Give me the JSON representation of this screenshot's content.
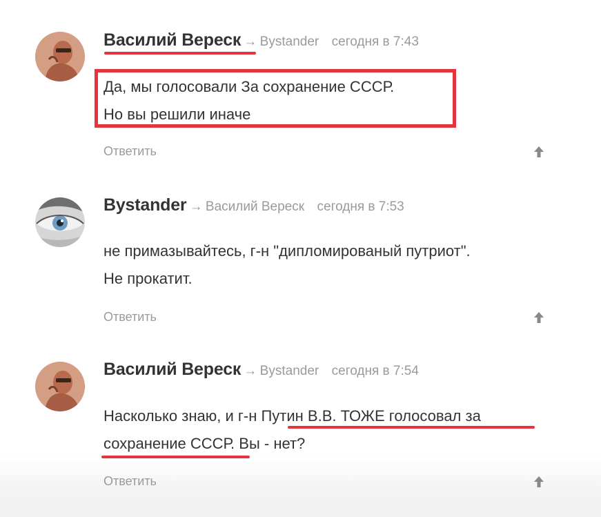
{
  "comments": [
    {
      "author": "Василий Вереск",
      "arrow": "→",
      "reply_to": "Bystander",
      "time": "сегодня в 7:43",
      "lines": [
        "Да, мы голосовали За сохранение СССР.",
        "Но вы решили иначе"
      ],
      "reply_label": "Ответить",
      "avatar_icon": "portrait-avatar-icon"
    },
    {
      "author": "Bystander",
      "arrow": "→",
      "reply_to": "Василий Вереск",
      "time": "сегодня в 7:53",
      "lines": [
        "не примазывайтесь, г-н \"дипломированый путриот\".",
        "Не прокатит."
      ],
      "reply_label": "Ответить",
      "avatar_icon": "eye-avatar-icon"
    },
    {
      "author": "Василий Вереск",
      "arrow": "→",
      "reply_to": "Bystander",
      "time": "сегодня в 7:54",
      "lines": [
        "Насколько знаю, и г-н Путин В.В. ТОЖЕ голосовал за",
        "сохранение СССР. Вы - нет?"
      ],
      "reply_label": "Ответить",
      "avatar_icon": "portrait-avatar-icon"
    }
  ],
  "colors": {
    "highlight": "#e3353b",
    "meta_text": "#9a9a9a",
    "body_text": "#333333"
  }
}
